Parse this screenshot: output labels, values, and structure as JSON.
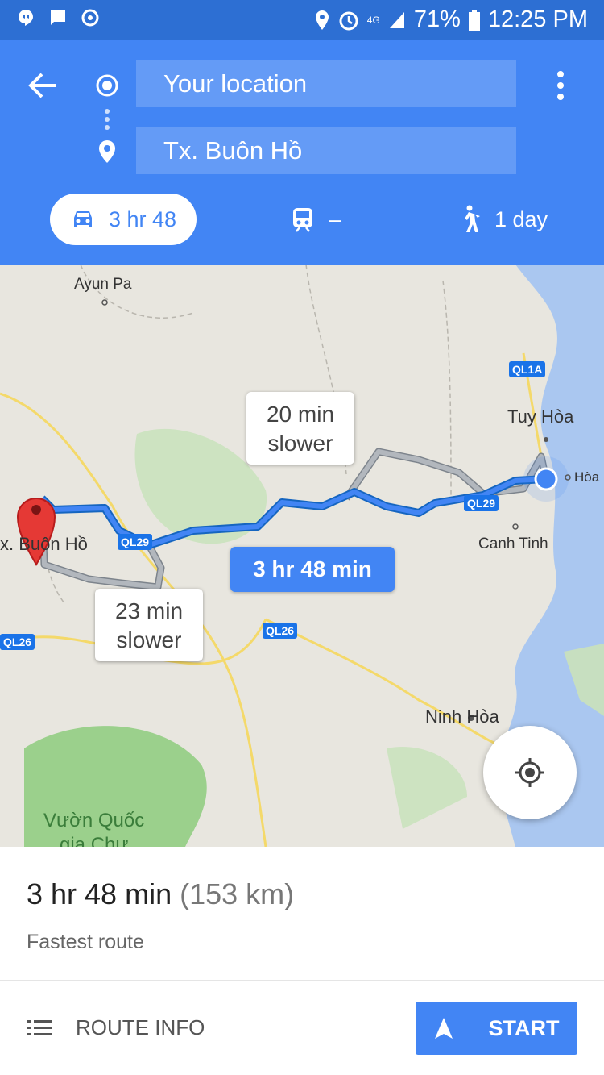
{
  "status_bar": {
    "battery": "71%",
    "time": "12:25 PM",
    "network": "4G",
    "icons": [
      "hangouts-icon",
      "message-icon",
      "sync-icon",
      "location-icon",
      "alarm-icon",
      "signal-icon",
      "battery-icon"
    ]
  },
  "directions": {
    "origin": "Your location",
    "destination": "Tx. Buôn Hồ"
  },
  "travel_modes": [
    {
      "mode": "driving",
      "icon": "car-icon",
      "label": "3 hr 48",
      "selected": true
    },
    {
      "mode": "transit",
      "icon": "train-icon",
      "label": "–",
      "selected": false
    },
    {
      "mode": "walking",
      "icon": "walk-icon",
      "label": "1 day",
      "selected": false
    }
  ],
  "map": {
    "places": [
      "Ayun Pa",
      "Tuy Hòa",
      "Hòa",
      "Canh Tinh",
      "x. Buôn Hồ",
      "Ninh Hòa",
      "Vườn Quốc",
      "gia Chư"
    ],
    "roads": [
      "QL1A",
      "QL29",
      "QL29",
      "QL26",
      "QL26"
    ],
    "callouts": {
      "primary": "3 hr 48 min",
      "alt1": [
        "20 min",
        "slower"
      ],
      "alt2": [
        "23 min",
        "slower"
      ]
    }
  },
  "summary": {
    "duration": "3 hr 48 min",
    "distance": "(153 km)",
    "subtitle": "Fastest route"
  },
  "actions": {
    "route_info": "ROUTE INFO",
    "start": "START"
  },
  "colors": {
    "primary_blue": "#4285f4",
    "status_blue": "#2d6fd3",
    "alt_route": "#9aa0a6",
    "pin_red": "#e53935"
  }
}
